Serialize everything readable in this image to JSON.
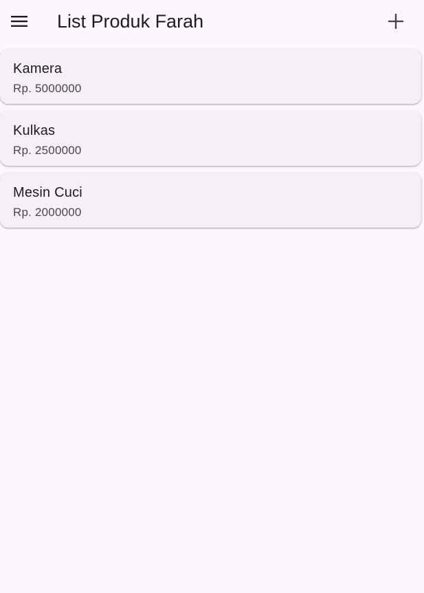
{
  "app_bar": {
    "title": "List Produk Farah",
    "menu_icon": "menu-icon",
    "add_icon": "add-icon"
  },
  "products": [
    {
      "name": "Kamera",
      "price": "Rp. 5000000"
    },
    {
      "name": "Kulkas",
      "price": "Rp. 2500000"
    },
    {
      "name": "Mesin Cuci",
      "price": "Rp. 2000000"
    }
  ],
  "colors": {
    "background": "#fdf7fd",
    "card": "#f6eff7",
    "text_primary": "#1d1b20",
    "text_secondary": "#49454f"
  }
}
